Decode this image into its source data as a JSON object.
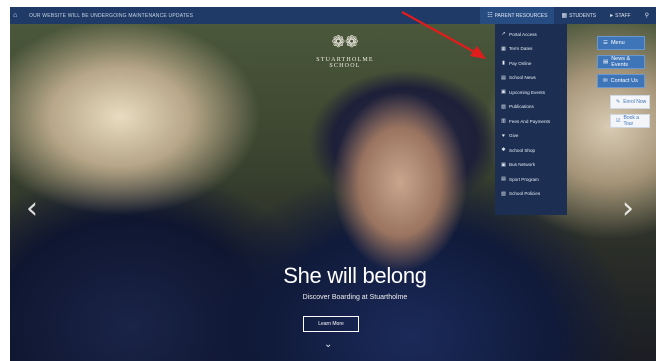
{
  "topbar": {
    "home_icon": "home-icon",
    "tagline": "OUR WEBSITE WILL BE UNDERGOING MAINTENANCE UPDATES",
    "items": [
      {
        "icon": "parents-icon",
        "glyph": "☷",
        "label": "PARENT RESOURCES"
      },
      {
        "icon": "students-icon",
        "glyph": "▦",
        "label": "STUDENTS"
      },
      {
        "icon": "staff-icon",
        "glyph": "▸",
        "label": "STAFF"
      }
    ],
    "search_icon": "search-icon"
  },
  "logo": {
    "crest": "❁❁",
    "name": "STUARTHOLME SCHOOL"
  },
  "parent_menu": {
    "items": [
      {
        "icon": "link-icon",
        "glyph": "↗",
        "label": "Portal Access"
      },
      {
        "icon": "calendar-icon",
        "glyph": "▦",
        "label": "Term Dates"
      },
      {
        "icon": "payment-icon",
        "glyph": "▮",
        "label": "Pay Online"
      },
      {
        "icon": "news-icon",
        "glyph": "▤",
        "label": "School News"
      },
      {
        "icon": "clipboard-icon",
        "glyph": "▣",
        "label": "Upcoming Events"
      },
      {
        "icon": "book-icon",
        "glyph": "▧",
        "label": "Publications"
      },
      {
        "icon": "fees-icon",
        "glyph": "▥",
        "label": "Fees And Payments"
      },
      {
        "icon": "heart-icon",
        "glyph": "♥",
        "label": "Give"
      },
      {
        "icon": "shop-icon",
        "glyph": "✱",
        "label": "School Shop"
      },
      {
        "icon": "bus-icon",
        "glyph": "▣",
        "label": "Bus Network"
      },
      {
        "icon": "program-icon",
        "glyph": "▤",
        "label": "Sport Program"
      },
      {
        "icon": "policy-icon",
        "glyph": "▨",
        "label": "School Policies"
      }
    ]
  },
  "side": {
    "menu": "Menu",
    "news_events": "News & Events",
    "contact": "Contact Us",
    "enrol": "Enrol Now",
    "visit": "Book a Tour"
  },
  "hero": {
    "headline": "She will belong",
    "subline": "Discover Boarding at Stuartholme",
    "cta": "Learn More",
    "prev_icon": "chevron-left-icon",
    "next_icon": "chevron-right-icon",
    "scroll_icon": "double-chevron-down-icon"
  },
  "colors": {
    "topbar": "#1f3a66",
    "menu_bg": "#1c2f52",
    "side_button": "#3e74b8",
    "annotation_arrow": "#e21b1b"
  }
}
